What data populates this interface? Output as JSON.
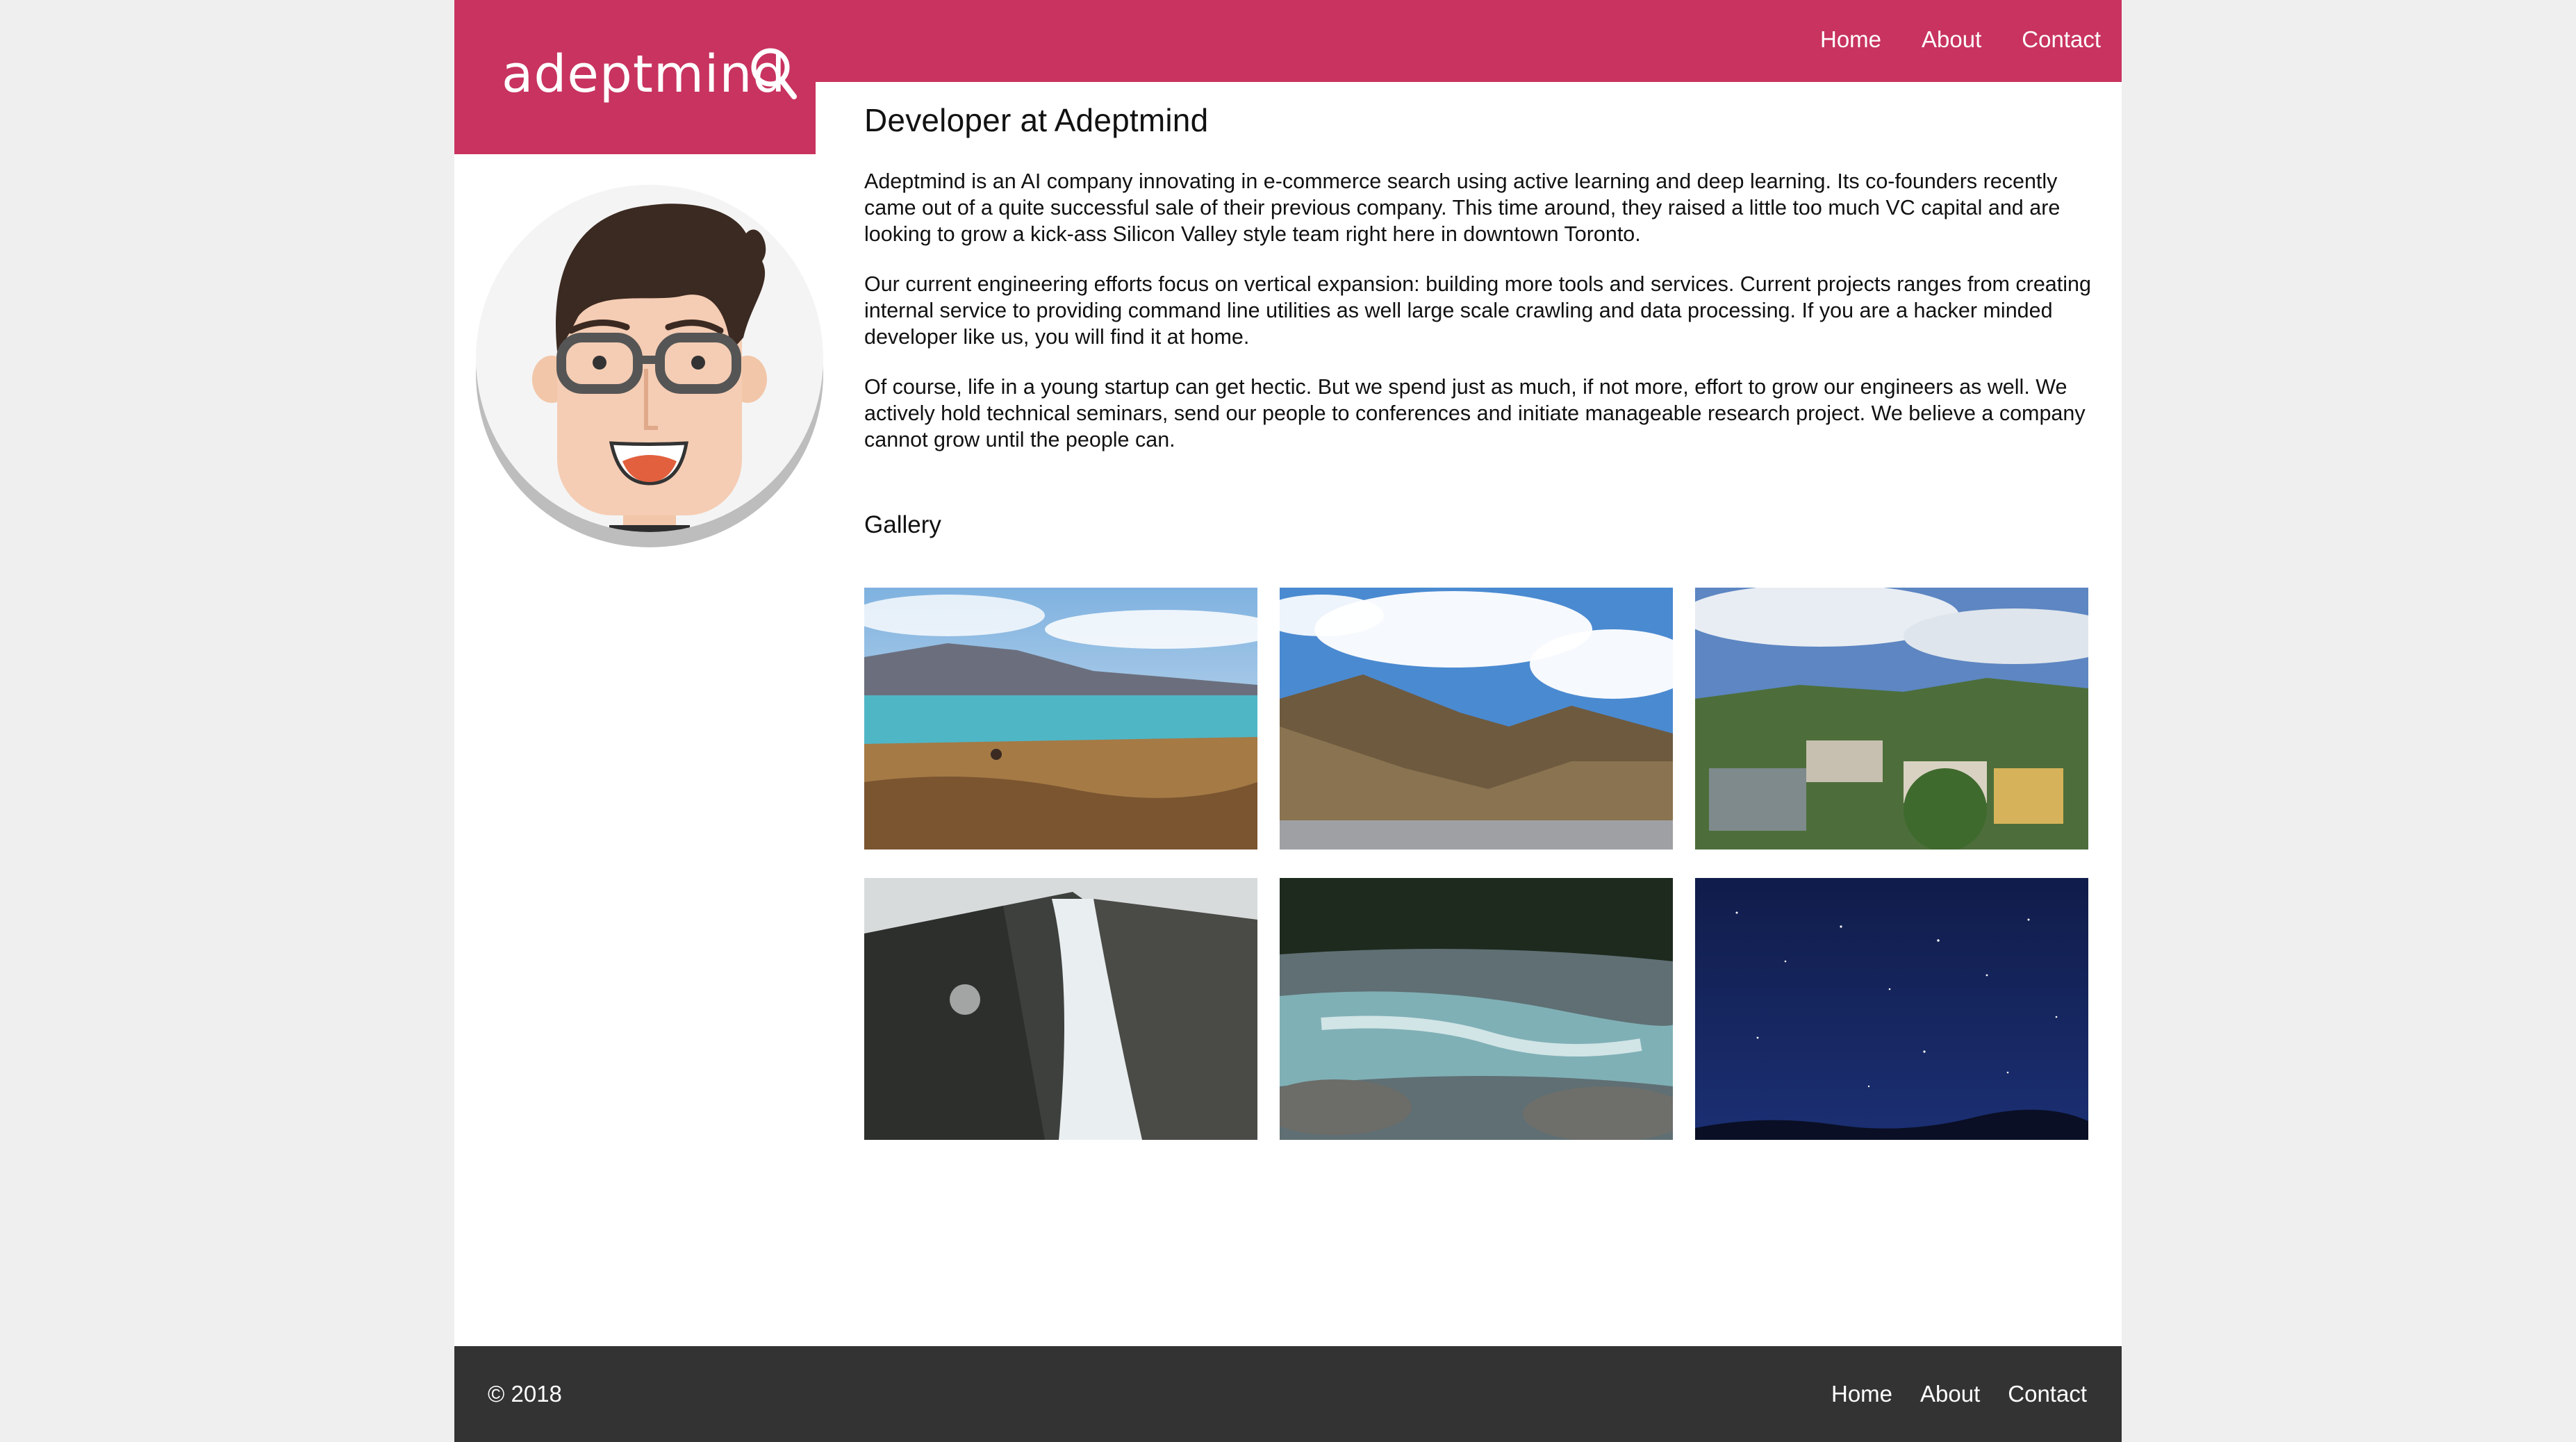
{
  "header": {
    "logo_text": "adeptmind",
    "nav": [
      "Home",
      "About",
      "Contact"
    ],
    "brand_color": "#c8335f"
  },
  "main": {
    "title": "Developer at Adeptmind",
    "paragraphs": [
      "Adeptmind is an AI company innovating in e-commerce search using active learning and deep learning. Its co-founders recently came out of a quite successful sale of their previous company. This time around, they raised a little too much VC capital and are looking to grow a kick-ass Silicon Valley style team right here in downtown Toronto.",
      "Our current engineering efforts focus on vertical expansion: building more tools and services. Current projects ranges from creating internal service to providing command line utilities as well large scale crawling and data processing. If you are a hacker minded developer like us, you will find it at home.",
      "Of course, life in a young startup can get hectic. But we spend just as much, if not more, effort to grow our engineers as well. We actively hold technical seminars, send our people to conferences and initiate manageable research project. We believe a company cannot grow until the people can."
    ],
    "gallery_title": "Gallery",
    "gallery": [
      {
        "icon": "lake-landscape-photo"
      },
      {
        "icon": "mountain-valley-photo"
      },
      {
        "icon": "hillside-town-photo"
      },
      {
        "icon": "waterfall-photo"
      },
      {
        "icon": "river-rapids-photo"
      },
      {
        "icon": "night-sky-photo"
      }
    ]
  },
  "footer": {
    "copyright": "© 2018",
    "nav": [
      "Home",
      "About",
      "Contact"
    ],
    "background": "#333333"
  }
}
